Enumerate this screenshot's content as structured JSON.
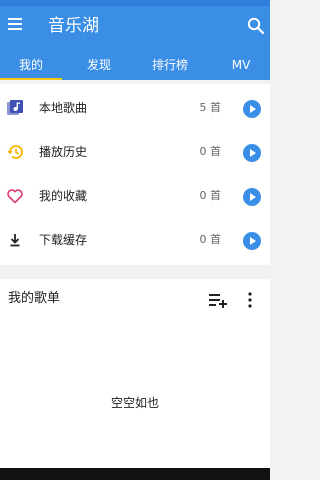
{
  "app_bar": {
    "title": "音乐湖",
    "menu_icon": "hamburger-menu-icon",
    "search_icon": "search-icon",
    "color": "#3a8ee6"
  },
  "tabs": [
    {
      "label": "我的",
      "active": true
    },
    {
      "label": "发现",
      "active": false
    },
    {
      "label": "排行榜",
      "active": false
    },
    {
      "label": "MV",
      "active": false
    }
  ],
  "tab_indicator_color": "#f5c518",
  "library": [
    {
      "label": "本地歌曲",
      "count": "5 首",
      "icon": "music-library-icon",
      "icon_color": "#3f51b5"
    },
    {
      "label": "播放历史",
      "count": "0 首",
      "icon": "history-icon",
      "icon_color": "#f5b400"
    },
    {
      "label": "我的收藏",
      "count": "0 首",
      "icon": "heart-icon",
      "icon_color": "#e0407a"
    },
    {
      "label": "下载缓存",
      "count": "0 首",
      "icon": "download-icon",
      "icon_color": "#222222"
    }
  ],
  "playlists": {
    "title": "我的歌单",
    "add_icon": "playlist-add-icon",
    "more_icon": "more-vertical-icon",
    "empty_text": "空空如也"
  }
}
